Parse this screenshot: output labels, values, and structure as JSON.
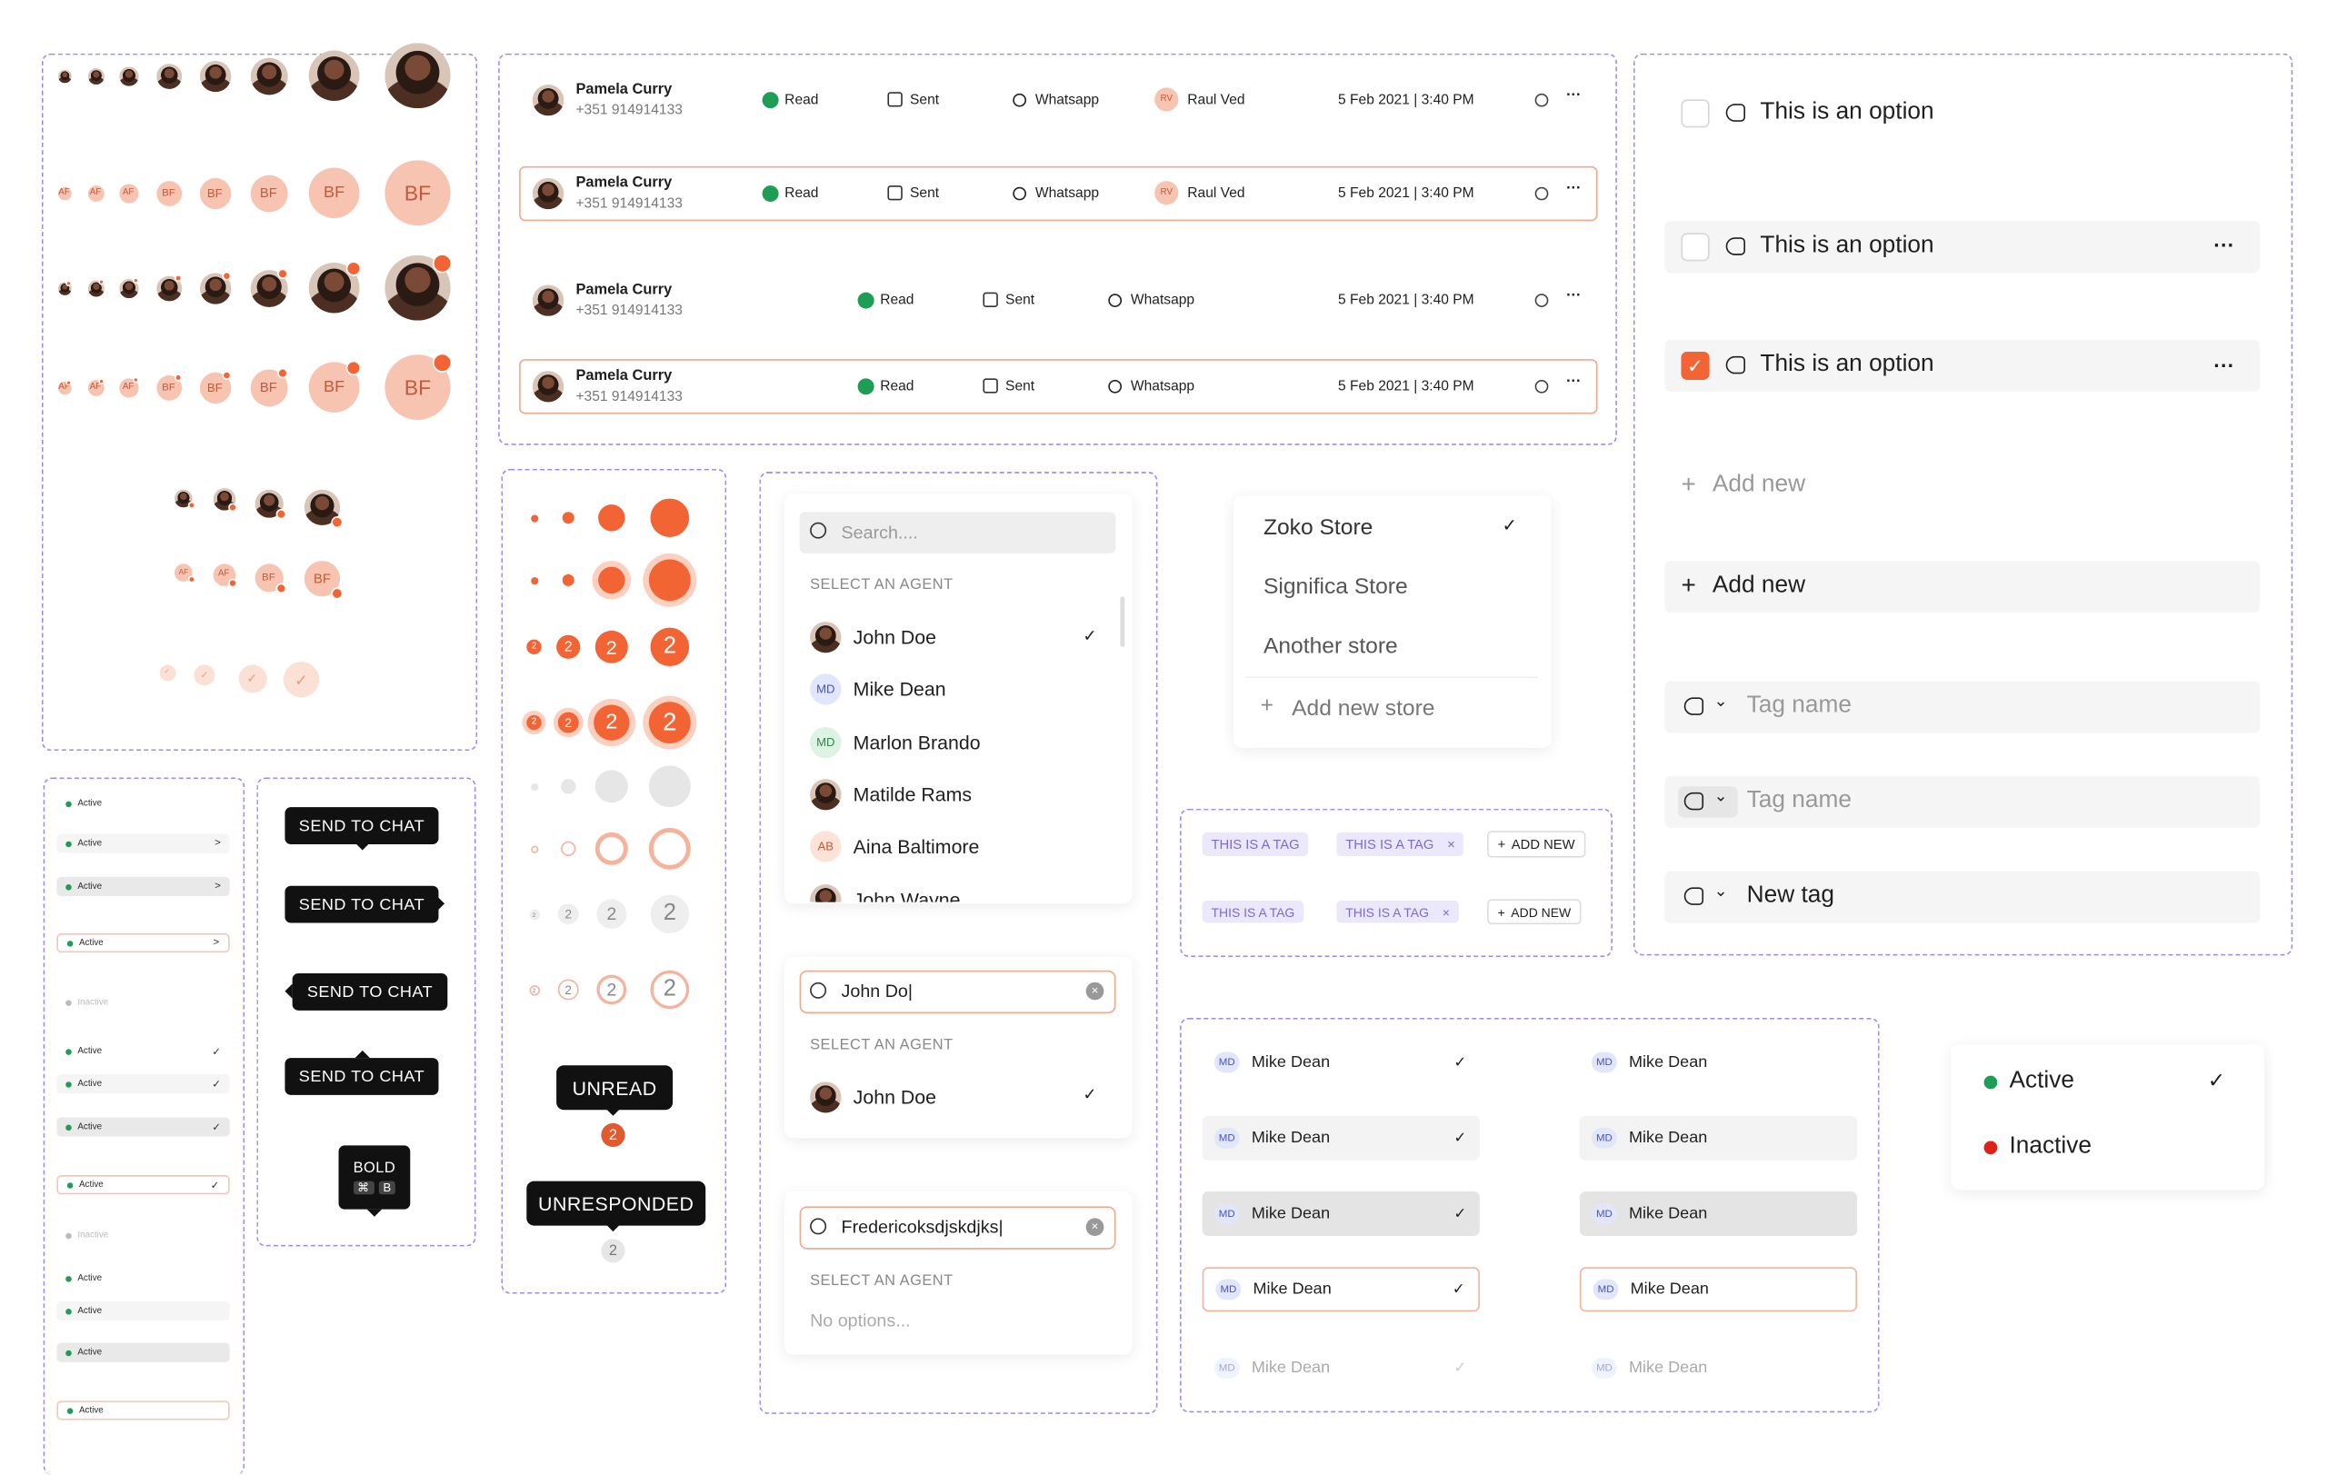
{
  "avatars": {
    "initials": "BF",
    "initials_small": "AF"
  },
  "messages": {
    "name": "Pamela Curry",
    "phone": "+351 914914133",
    "status_read": "Read",
    "status_sent": "Sent",
    "channel": "Whatsapp",
    "agent": "Raul Ved",
    "agent_initials": "RV",
    "datetime": "5 Feb 2021 | 3:40 PM"
  },
  "statuses": {
    "active": "Active",
    "inactive": "Inactive"
  },
  "tooltips": {
    "send": "SEND TO CHAT",
    "bold": "BOLD",
    "cmd": "⌘",
    "key": "B"
  },
  "badges": {
    "count": "2",
    "unread": "UNREAD",
    "unresponded": "UNRESPONDED"
  },
  "agent_search": {
    "placeholder": "Search....",
    "section": "SELECT AN AGENT",
    "agents": [
      {
        "name": "John Doe",
        "initials": "",
        "checked": true
      },
      {
        "name": "Mike Dean",
        "initials": "MD"
      },
      {
        "name": "Marlon Brando",
        "initials": "MD"
      },
      {
        "name": "Matilde Rams",
        "initials": ""
      },
      {
        "name": "Aina Baltimore",
        "initials": "AB"
      },
      {
        "name": "John Wayne",
        "initials": ""
      }
    ],
    "query1": "John Do|",
    "result1": "John Doe",
    "query2": "Fredericoksdjskdjks|",
    "no_options": "No options..."
  },
  "stores": {
    "items": [
      "Zoko Store",
      "Significa Store",
      "Another store"
    ],
    "add": "Add new store"
  },
  "tags": {
    "tag": "THIS IS A TAG",
    "add": "ADD NEW",
    "remove": "×"
  },
  "options": {
    "option_label": "This is an option",
    "more": "···",
    "add_new": "Add new",
    "tag_placeholder": "Tag name",
    "new_tag": "New tag"
  },
  "mike": {
    "initials": "MD",
    "name": "Mike Dean"
  },
  "status_menu": {
    "active": "Active",
    "inactive": "Inactive"
  },
  "colors": {
    "accent": "#f36434",
    "frame": "#9b8cf5",
    "green": "#1e9e55",
    "red": "#e0201a"
  }
}
